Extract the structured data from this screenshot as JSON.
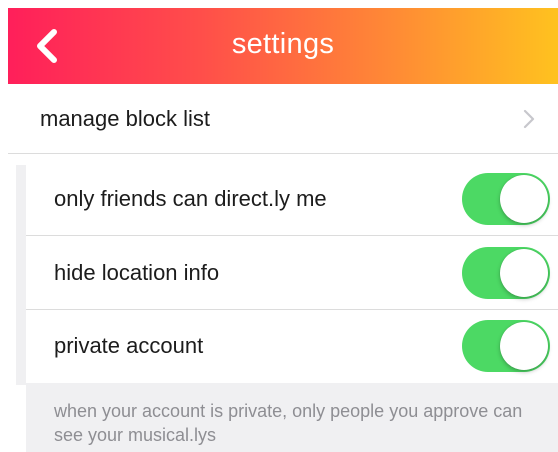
{
  "header": {
    "title": "settings",
    "back_icon": "chevron-left-icon",
    "gradient": [
      "#ff1f5a",
      "#ff8a35",
      "#ffc21f"
    ]
  },
  "block_list": {
    "label": "manage block list",
    "icon": "chevron-right-icon"
  },
  "toggles": [
    {
      "label": "only friends can direct.ly me",
      "on": true
    },
    {
      "label": "hide location info",
      "on": true
    },
    {
      "label": "private account",
      "on": true
    }
  ],
  "footer": {
    "note": "when your account is private, only people you approve can see your musical.lys"
  },
  "colors": {
    "switch_on": "#4cd964",
    "footer_bg": "#f0f0f2",
    "footer_text": "#8e8e93"
  }
}
